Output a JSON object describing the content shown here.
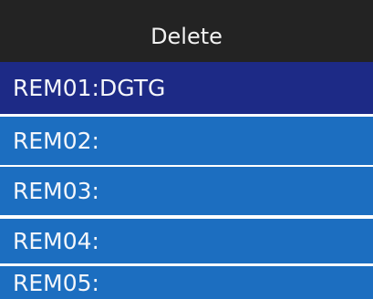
{
  "header": {
    "title": "Delete"
  },
  "list": {
    "items": [
      {
        "label": "REM01:DGTG",
        "selected": true
      },
      {
        "label": "REM02:",
        "selected": false
      },
      {
        "label": "REM03:",
        "selected": false
      },
      {
        "label": "REM04:",
        "selected": false
      },
      {
        "label": "REM05:",
        "selected": false
      }
    ]
  },
  "colors": {
    "header_bg": "#232323",
    "item_bg": "#1c6ec0",
    "selected_bg": "#1d2a86",
    "separator": "#ffffff",
    "text": "#f4f6fa"
  }
}
